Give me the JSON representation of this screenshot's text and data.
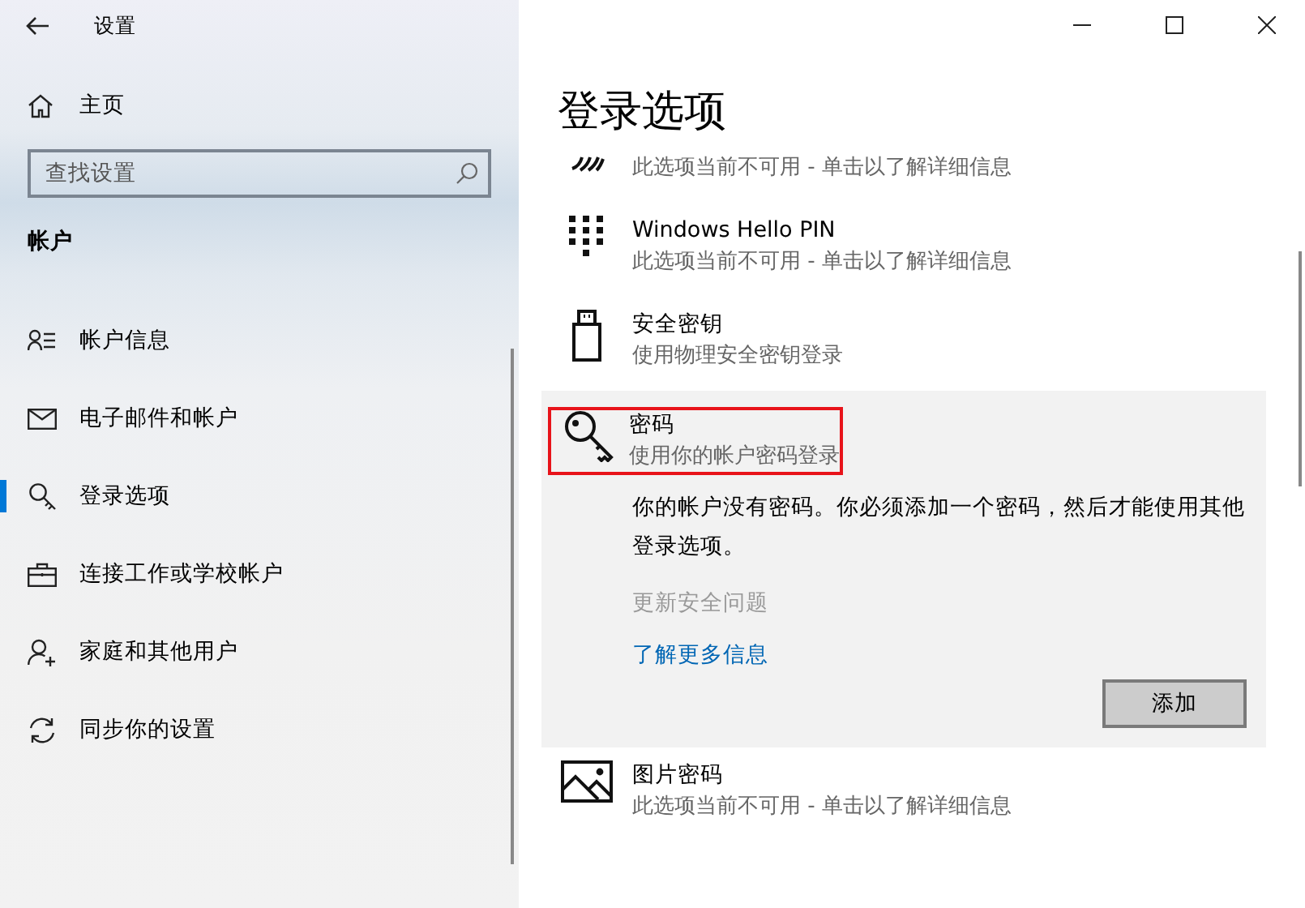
{
  "window": {
    "title": "设置"
  },
  "sidebar": {
    "home": "主页",
    "search": {
      "placeholder": "查找设置"
    },
    "section": "帐户",
    "items": [
      {
        "kind": "person-list",
        "label": "帐户信息",
        "selected": false
      },
      {
        "kind": "mail",
        "label": "电子邮件和帐户",
        "selected": false
      },
      {
        "kind": "key",
        "label": "登录选项",
        "selected": true
      },
      {
        "kind": "briefcase",
        "label": "连接工作或学校帐户",
        "selected": false
      },
      {
        "kind": "person-add",
        "label": "家庭和其他用户",
        "selected": false
      },
      {
        "kind": "sync",
        "label": "同步你的设置",
        "selected": false
      }
    ]
  },
  "page": {
    "title": "登录选项",
    "options": [
      {
        "kind": "fingerprint",
        "subtitle": "此选项当前不可用 - 单击以了解详细信息"
      },
      {
        "kind": "pin",
        "title": "Windows Hello PIN",
        "subtitle": "此选项当前不可用 - 单击以了解详细信息"
      },
      {
        "kind": "usb-key",
        "title": "安全密钥",
        "subtitle": "使用物理安全密钥登录"
      },
      {
        "kind": "key",
        "title": "密码",
        "subtitle": "使用你的帐户密码登录",
        "expanded": true,
        "highlighted": true,
        "details": {
          "message": "你的帐户没有密码。你必须添加一个密码，然后才能使用其他登录选项。",
          "links": [
            {
              "label": "更新安全问题",
              "disabled": true
            },
            {
              "label": "了解更多信息",
              "disabled": false
            }
          ],
          "button": "添加"
        }
      },
      {
        "kind": "picture",
        "title": "图片密码",
        "subtitle": "此选项当前不可用 - 单击以了解详细信息"
      }
    ]
  }
}
